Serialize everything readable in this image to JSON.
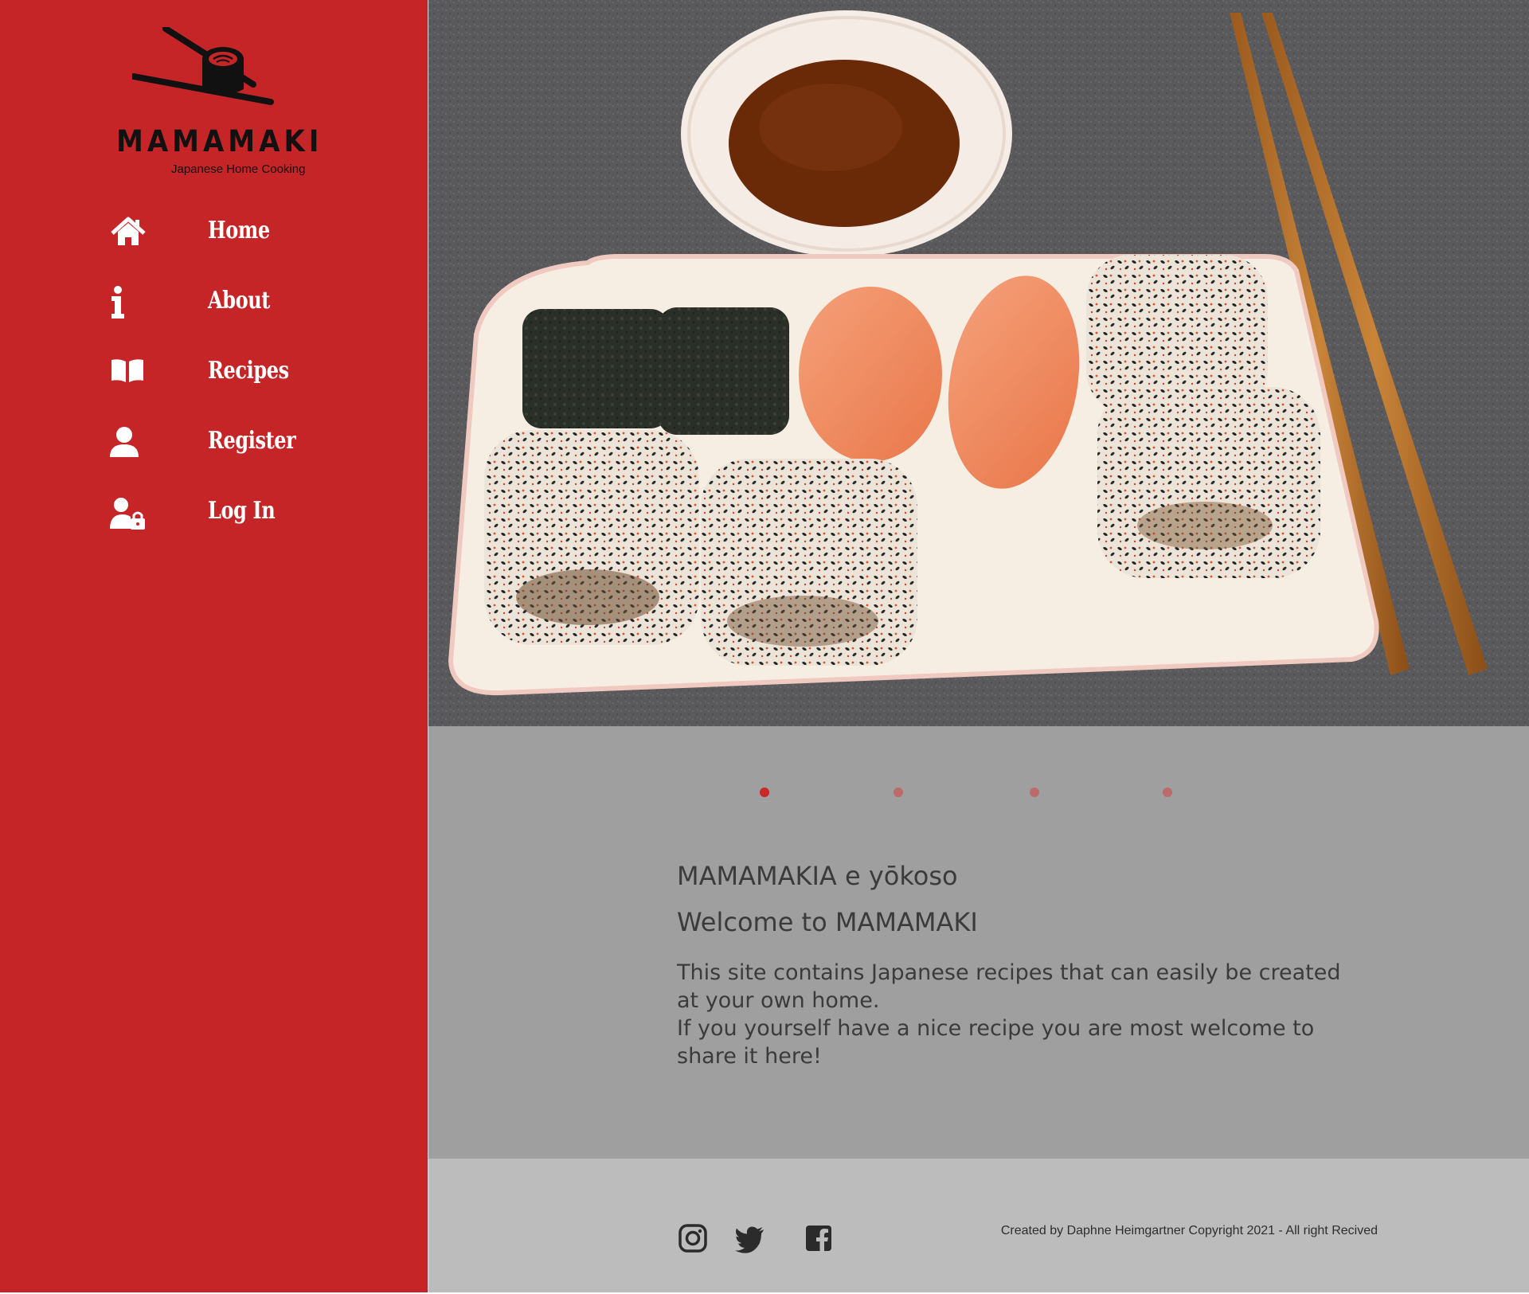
{
  "brand": {
    "name": "MAMAMAKI",
    "tagline": "Japanese Home Cooking"
  },
  "nav": {
    "items": [
      {
        "label": "Home",
        "icon": "home-icon"
      },
      {
        "label": "About",
        "icon": "info-icon"
      },
      {
        "label": "Recipes",
        "icon": "book-icon"
      },
      {
        "label": "Register",
        "icon": "user-icon"
      },
      {
        "label": "Log In",
        "icon": "user-lock-icon"
      }
    ]
  },
  "hero": {
    "image": "photo of sushi rolls and salmon nigiri on a rectangular plate with a dish of soy sauce and chopsticks",
    "slides_total": 4,
    "active_slide": 1
  },
  "content": {
    "greeting": "MAMAMAKIA e yōkoso",
    "welcome": "Welcome to MAMAMAKI",
    "intro_line1": "This site contains Japanese recipes that can easily be created at your own home.",
    "intro_line2": "If you yourself have a nice recipe you are most welcome to share it here!"
  },
  "footer": {
    "social": [
      "instagram-icon",
      "twitter-icon",
      "facebook-icon"
    ],
    "credit": "Created by Daphne Heimgartner Copyright 2021 - All right Recived"
  },
  "colors": {
    "sidebar": "#c62527",
    "content_bg": "#9f9f9f",
    "footer_bg": "#bcbcbc",
    "dot_active": "#cd2729",
    "dot_inactive": "#bd6a6b",
    "text": "#3b3b3b"
  }
}
